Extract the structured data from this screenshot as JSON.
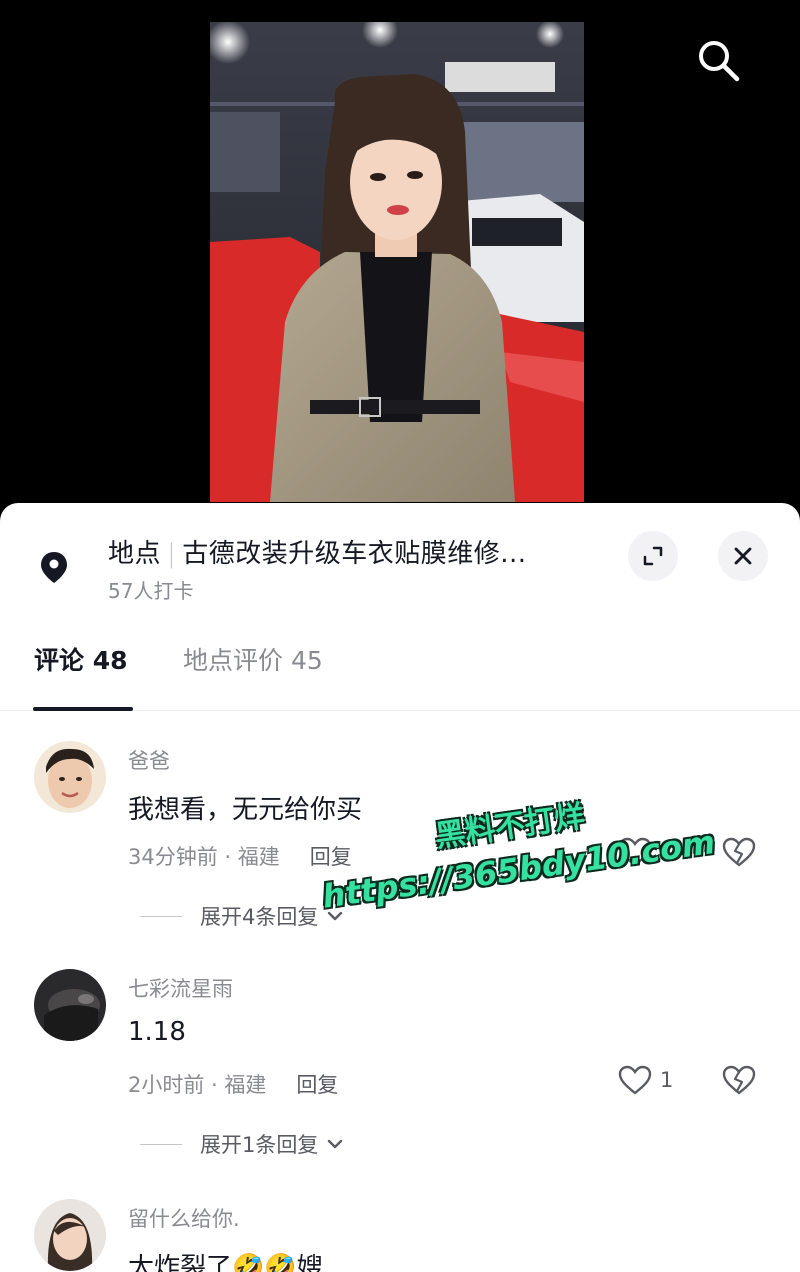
{
  "location": {
    "label": "地点",
    "name": "古德改装升级车衣贴膜维修...",
    "checkins": "57人打卡"
  },
  "tabs": [
    {
      "label": "评论 48",
      "active": true
    },
    {
      "label": "地点评价 45",
      "active": false
    }
  ],
  "comments": [
    {
      "user": "爸爸",
      "text": "我想看，无元给你买",
      "meta": "34分钟前 · 福建",
      "reply": "回复",
      "likes": "",
      "expand": "展开4条回复"
    },
    {
      "user": "七彩流星雨",
      "text": "1.18",
      "meta": "2小时前 · 福建",
      "reply": "回复",
      "likes": "1",
      "expand": "展开1条回复"
    },
    {
      "user": "留什么给你.",
      "text": "太炸裂了🤣🤣嫂"
    }
  ],
  "watermark": {
    "line1": "黑料不打烊",
    "line2": "https://365bdy10.com"
  },
  "icons": {
    "search": "search-icon",
    "pin": "location-pin-icon",
    "expand": "expand-icon",
    "close": "close-icon",
    "like": "heart-icon",
    "dislike": "broken-heart-icon",
    "chevron": "chevron-down-icon"
  },
  "colors": {
    "primary_text": "#161823",
    "secondary_text": "#8a8b91",
    "watermark": "#35e0a0"
  }
}
